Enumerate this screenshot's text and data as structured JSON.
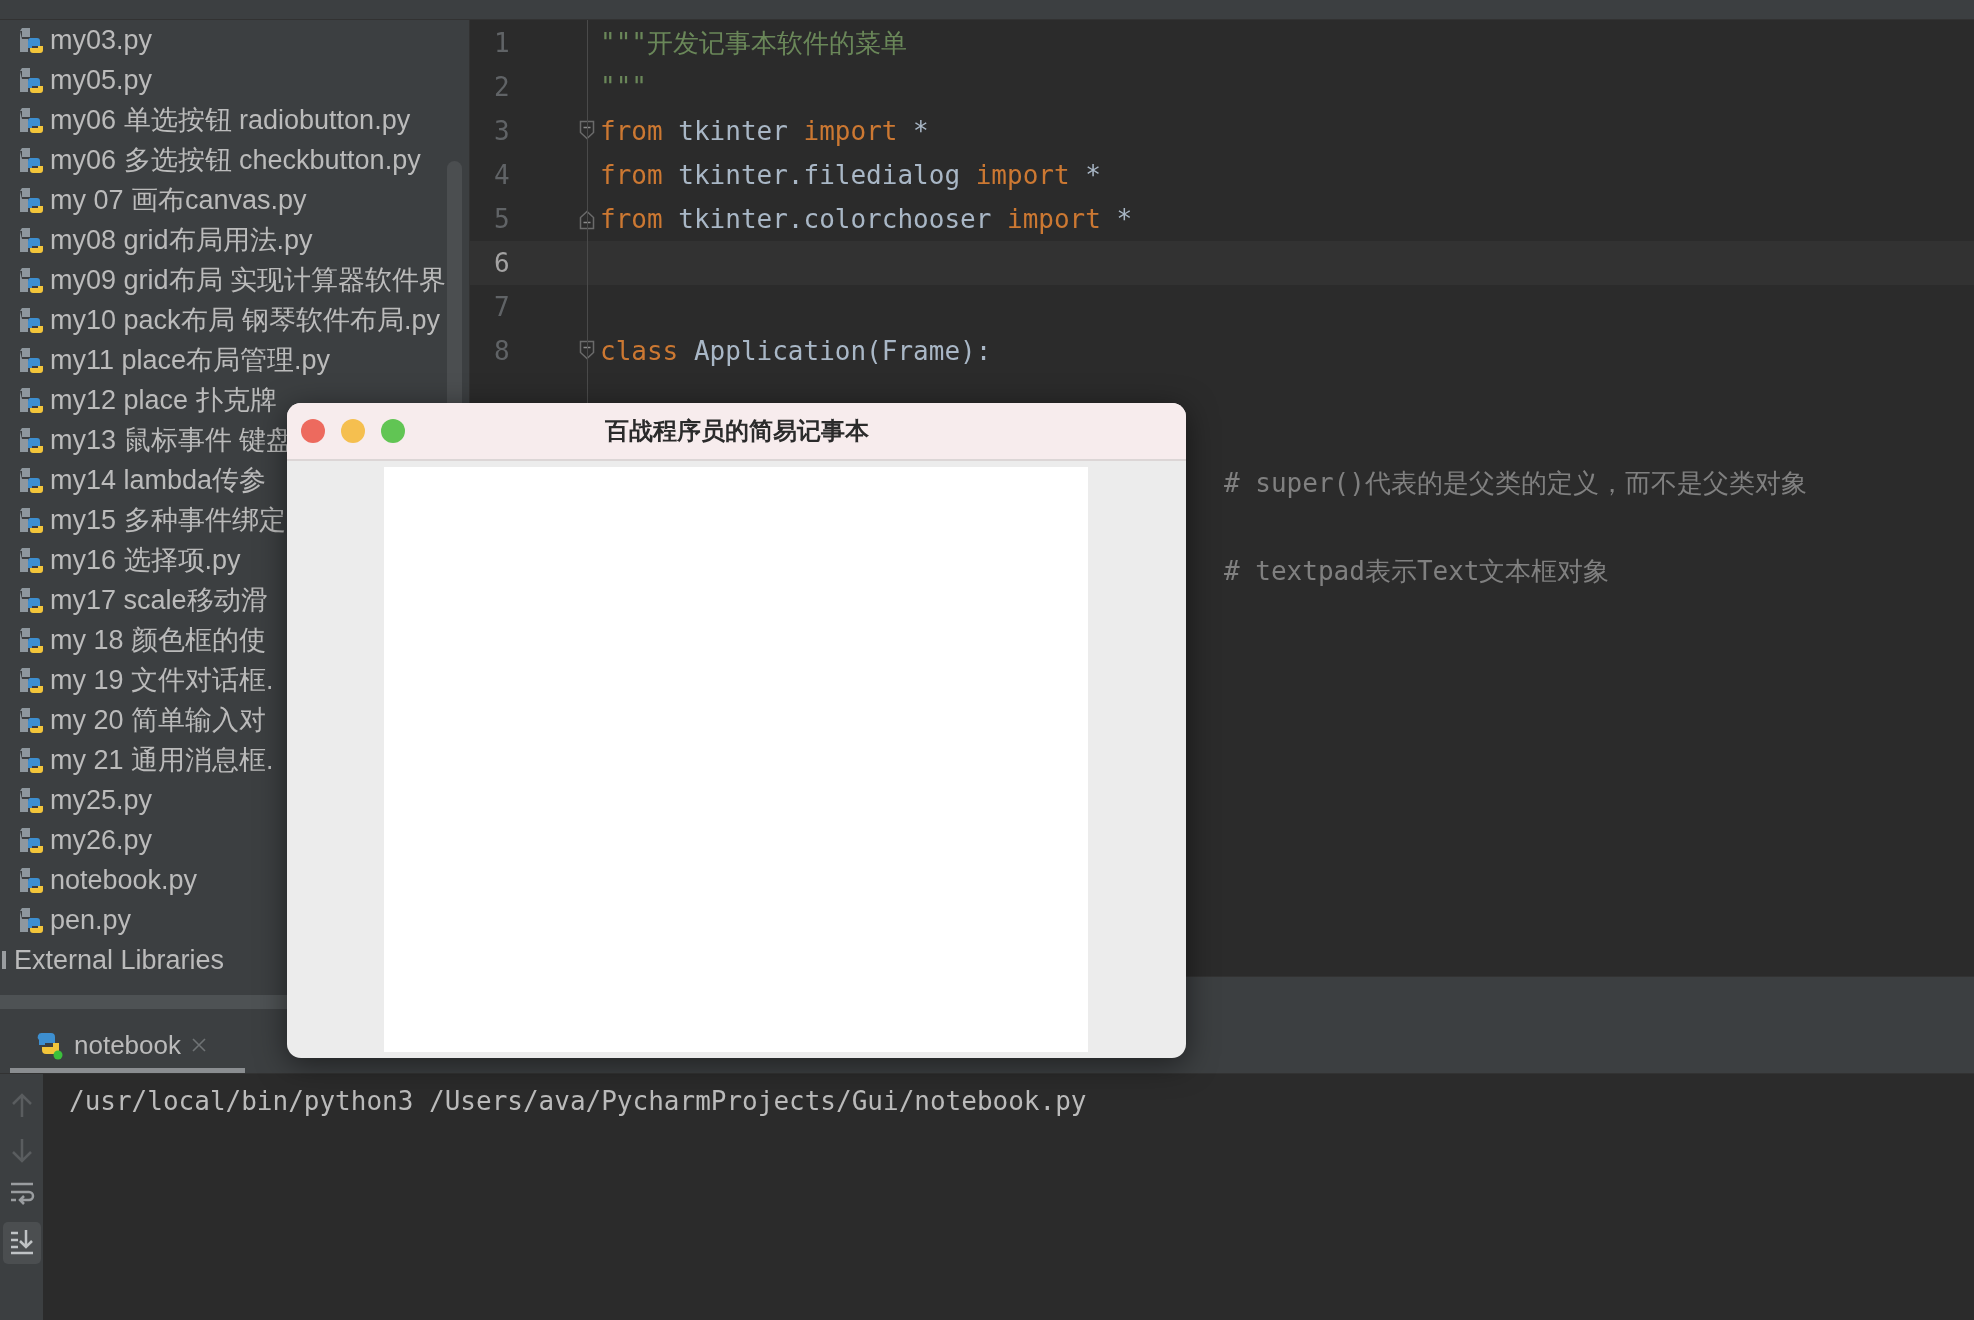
{
  "project_tree": {
    "files": [
      "my03.py",
      "my05.py",
      "my06 单选按钮 radiobutton.py",
      "my06 多选按钮 checkbutton.py",
      "my 07 画布canvas.py",
      "my08 grid布局用法.py",
      "my09 grid布局 实现计算器软件界",
      "my10 pack布局 钢琴软件布局.py",
      "my11 place布局管理.py",
      "my12 place 扑克牌",
      "my13 鼠标事件 键盘",
      "my14 lambda传参",
      "my15 多种事件绑定",
      "my16 选择项.py",
      "my17 scale移动滑",
      "my 18 颜色框的使",
      "my 19 文件对话框.",
      "my 20 简单输入对",
      "my 21 通用消息框.",
      "my25.py",
      "my26.py",
      "notebook.py",
      "pen.py"
    ],
    "external_libraries": "External Libraries"
  },
  "editor": {
    "lines": [
      {
        "number": "1",
        "current": false,
        "kind": "plain",
        "tokens": [
          {
            "kind": "string",
            "text": "\"\"\"开发记事本软件的菜单"
          }
        ]
      },
      {
        "number": "2",
        "current": false,
        "kind": "plain",
        "tokens": [
          {
            "kind": "string",
            "text": "\"\"\""
          }
        ]
      },
      {
        "number": "3",
        "current": false,
        "kind": "fold-start",
        "tokens": [
          {
            "kind": "keyword",
            "text": "from"
          },
          {
            "kind": "plain",
            "text": " tkinter "
          },
          {
            "kind": "keyword",
            "text": "import"
          },
          {
            "kind": "plain",
            "text": " *"
          }
        ]
      },
      {
        "number": "4",
        "current": false,
        "kind": "plain",
        "tokens": [
          {
            "kind": "keyword",
            "text": "from"
          },
          {
            "kind": "plain",
            "text": " tkinter.filedialog "
          },
          {
            "kind": "keyword",
            "text": "import"
          },
          {
            "kind": "plain",
            "text": " *"
          }
        ]
      },
      {
        "number": "5",
        "current": false,
        "kind": "fold-end",
        "tokens": [
          {
            "kind": "keyword",
            "text": "from"
          },
          {
            "kind": "plain",
            "text": " tkinter.colorchooser "
          },
          {
            "kind": "keyword",
            "text": "import"
          },
          {
            "kind": "plain",
            "text": " *"
          }
        ]
      },
      {
        "number": "6",
        "current": true,
        "kind": "plain"
      },
      {
        "number": "7",
        "current": false,
        "kind": "plain"
      },
      {
        "number": "8",
        "current": false,
        "kind": "fold-start",
        "tokens": [
          {
            "kind": "keyword",
            "text": "class"
          },
          {
            "kind": "plain",
            "text": " Application(Frame):"
          }
        ]
      }
    ],
    "comments_beside_dialog": [
      "# super()代表的是父类的定义，而不是父类对象",
      "# textpad表示Text文本框对象"
    ]
  },
  "dialog": {
    "title": "百战程序员的简易记事本"
  },
  "run_panel": {
    "tab": {
      "label": "notebook",
      "selected": true
    },
    "output": "/usr/local/bin/python3 /Users/ava/PycharmProjects/Gui/notebook.py"
  }
}
